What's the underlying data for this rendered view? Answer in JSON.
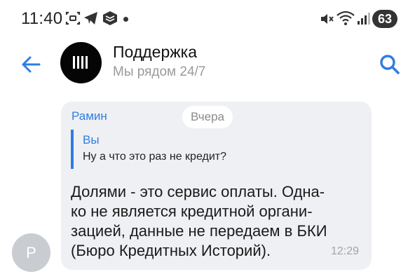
{
  "status_bar": {
    "time": "11:40",
    "battery": "63",
    "icons": [
      "screenshot-icon",
      "telegram-icon",
      "vk-icon",
      "mute-icon",
      "wifi-icon",
      "signal-icon"
    ]
  },
  "header": {
    "title": "Поддержка",
    "subtitle": "Мы рядом 24/7",
    "accent": "#2f7de1"
  },
  "message": {
    "sender_initial": "Р",
    "sender_name": "Рамин",
    "date_label": "Вчера",
    "reply": {
      "author": "Вы",
      "text": "Ну а что это раз не кредит?"
    },
    "lines": [
      "Долями - это сервис оплаты. Одна-",
      "ко не является кредитной органи-",
      "зацией, данные не передаем в БКИ",
      "(Бюро Кредитных Историй)."
    ],
    "time": "12:29",
    "bubble_color": "#eef0f3"
  }
}
